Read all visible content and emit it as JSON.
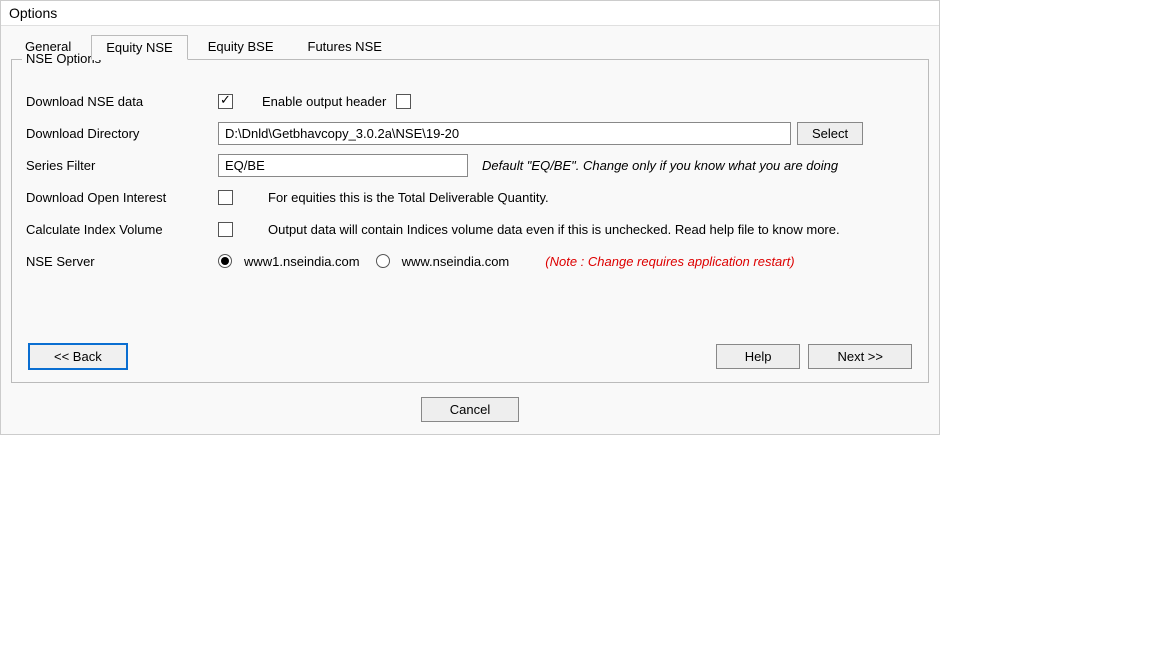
{
  "window": {
    "title": "Options"
  },
  "tabs": [
    {
      "label": "General"
    },
    {
      "label": "Equity NSE"
    },
    {
      "label": "Equity BSE"
    },
    {
      "label": "Futures NSE"
    }
  ],
  "fieldset": {
    "legend": "NSE Options",
    "download_nse_label": "Download NSE data",
    "download_nse_checked": true,
    "enable_header_label": "Enable output header",
    "enable_header_checked": false,
    "download_dir_label": "Download Directory",
    "download_dir_value": "D:\\Dnld\\Getbhavcopy_3.0.2a\\NSE\\19-20",
    "select_btn": "Select",
    "series_filter_label": "Series Filter",
    "series_filter_value": "EQ/BE",
    "series_filter_hint": "Default \"EQ/BE\". Change only if you know what you are doing",
    "download_oi_label": "Download Open Interest",
    "download_oi_checked": false,
    "download_oi_desc": "For equities this is the Total Deliverable Quantity.",
    "calc_index_label": "Calculate Index Volume",
    "calc_index_checked": false,
    "calc_index_desc": "Output data will contain Indices volume data even if this is unchecked. Read help file to know more.",
    "nse_server_label": "NSE Server",
    "server1": "www1.nseindia.com",
    "server2": "www.nseindia.com",
    "server_note": "(Note : Change requires application restart)"
  },
  "buttons": {
    "back": "<< Back",
    "help": "Help",
    "next": "Next >>",
    "cancel": "Cancel"
  }
}
